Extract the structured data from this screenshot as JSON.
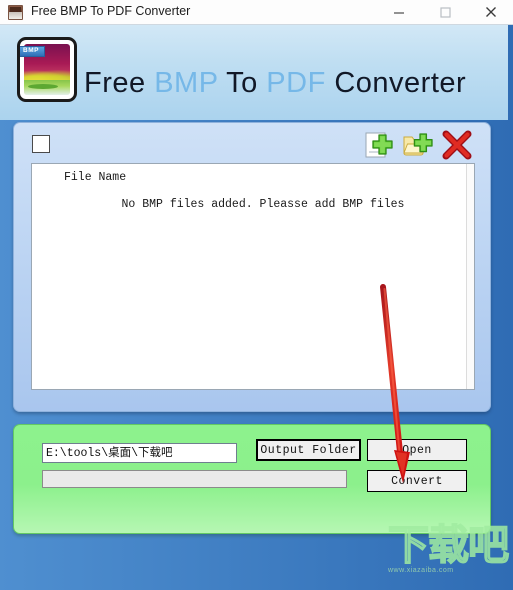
{
  "window": {
    "title": "Free BMP To PDF Converter",
    "icon": "app-icon",
    "minimize_label": "—",
    "maximize_label": "□",
    "close_label": "✕"
  },
  "header": {
    "logo_tag": "BMP",
    "brand_parts": [
      {
        "text": "Free",
        "color": "#111827"
      },
      {
        "text": "BMP",
        "color": "#76b8e8"
      },
      {
        "text": "To",
        "color": "#111827"
      },
      {
        "text": "PDF",
        "color": "#76b8e8"
      },
      {
        "text": "Converter",
        "color": "#111827"
      }
    ]
  },
  "file_panel": {
    "select_all_checked": false,
    "toolbar": [
      {
        "name": "add-files-icon",
        "label": "Add Files"
      },
      {
        "name": "add-folder-icon",
        "label": "Add Folder"
      },
      {
        "name": "remove-icon",
        "label": "Remove"
      }
    ],
    "columns": [
      "File Name"
    ],
    "rows": [],
    "empty_message": "No BMP files added. Pleasse add BMP files"
  },
  "action_panel": {
    "output_path_value": "E:\\tools\\桌面\\下载吧",
    "output_path_placeholder": "",
    "progress_percent": 0,
    "buttons": {
      "output_folder": "Output Folder",
      "open": "Open",
      "convert": "Convert"
    }
  },
  "annotation": {
    "arrow_color": "#d91f1f",
    "arrow_target": "Convert"
  },
  "watermark": {
    "text": "下载吧",
    "subtext": "www.xiazaiba.com"
  },
  "colors": {
    "title_bar": "#fdfdfd",
    "header_bg": "#bfdef2",
    "panel_blue": "#b9d2f2",
    "panel_green": "#8cf08c",
    "window_border": "#2f6cb4",
    "brand_accent": "#76b8e8"
  }
}
